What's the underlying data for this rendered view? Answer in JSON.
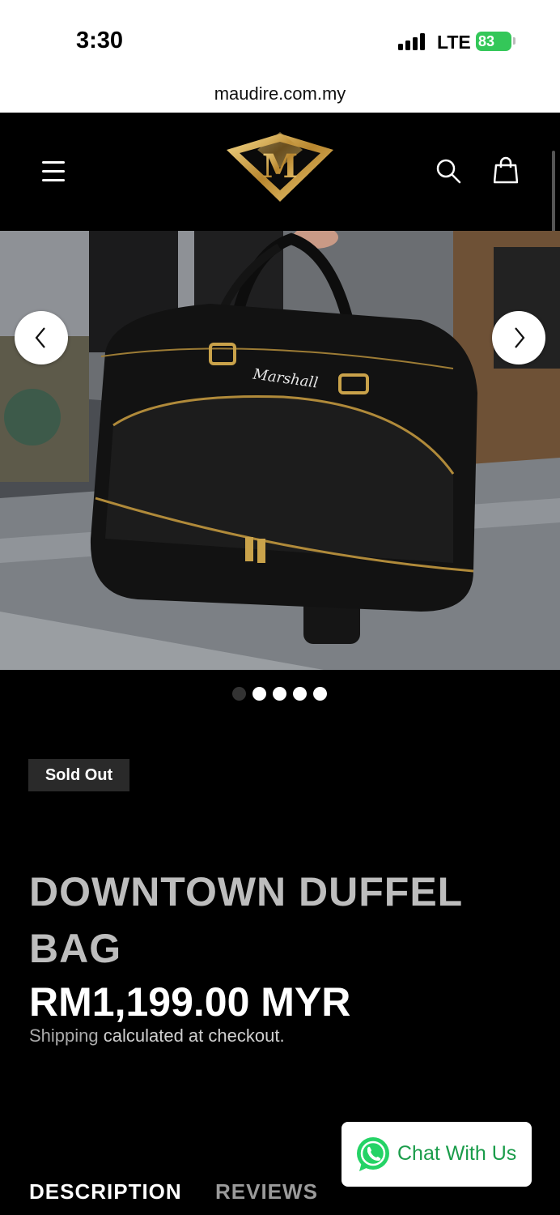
{
  "status_bar": {
    "time": "3:30",
    "network": "LTE",
    "battery": "83"
  },
  "browser": {
    "url": "maudire.com.my"
  },
  "header": {
    "logo_letter": "M",
    "icons": [
      "menu-icon",
      "search-icon",
      "cart-icon"
    ]
  },
  "gallery": {
    "slide_count": 5,
    "active_index": 0,
    "bag_brand": "Marshall"
  },
  "product": {
    "badge": "Sold Out",
    "title": "DOWNTOWN DUFFEL BAG",
    "price": "RM1,199.00 MYR",
    "shipping_link": "Shipping",
    "shipping_rest": " calculated at checkout."
  },
  "tabs": [
    {
      "label": "DESCRIPTION",
      "active": true
    },
    {
      "label": "REVIEWS",
      "active": false
    }
  ],
  "chat_widget": {
    "label": "Chat With Us"
  },
  "colors": {
    "background": "#000000",
    "gold": "#c9a24a",
    "whatsapp_green": "#25d366",
    "battery_green": "#34c759"
  }
}
